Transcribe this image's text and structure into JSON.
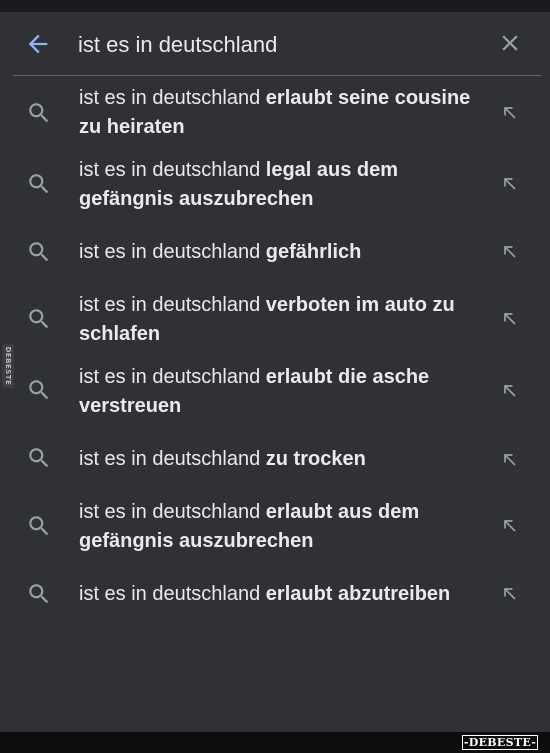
{
  "search": {
    "query": "ist es in deutschland"
  },
  "icons": {
    "back": "arrow-back-icon",
    "clear": "close-icon",
    "suggestion": "search-icon",
    "fill": "arrow-up-left-icon"
  },
  "colors": {
    "background": "#303134",
    "back_arrow": "#8ab4f8",
    "text": "#e8eaed",
    "icon": "#9aa0a6"
  },
  "suggestions": [
    {
      "prefix": "ist es in deutschland ",
      "completion": "erlaubt seine cousine zu heiraten"
    },
    {
      "prefix": "ist es in deutschland ",
      "completion": "legal aus dem gefängnis auszubrechen"
    },
    {
      "prefix": "ist es in deutschland ",
      "completion": "gefährlich"
    },
    {
      "prefix": "ist es in deutschland ",
      "completion": "verboten im auto zu schlafen"
    },
    {
      "prefix": "ist es in deutschland ",
      "completion": "erlaubt die asche verstreuen"
    },
    {
      "prefix": "ist es in deutschland ",
      "completion": "zu trocken"
    },
    {
      "prefix": "ist es in deutschland ",
      "completion": "erlaubt aus dem gefängnis auszubrechen"
    },
    {
      "prefix": "ist es in deutschland ",
      "completion": "erlaubt abzutreiben"
    }
  ],
  "watermark": {
    "side_text": "DEBESTE",
    "logo_text": "-DEBESTE-"
  }
}
